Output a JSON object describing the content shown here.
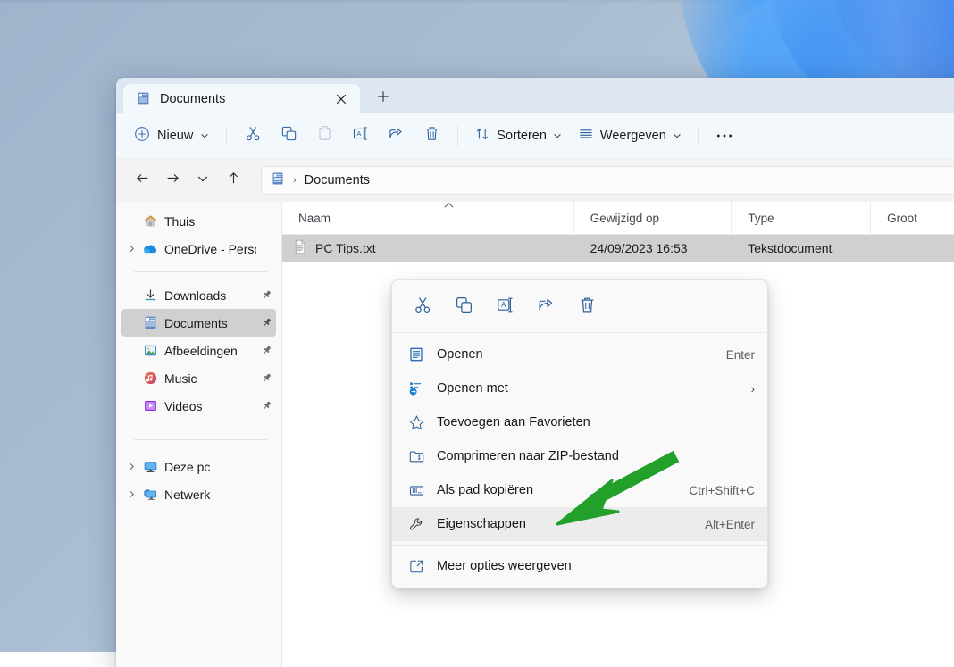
{
  "window": {
    "title": "Documents",
    "tab": {
      "label": "Documents",
      "icon": "documents-folder-icon",
      "close_icon": "close-icon"
    },
    "new_tab_icon": "plus-icon"
  },
  "toolbar": {
    "new_label": "Nieuw",
    "new_icon": "plus-circle-icon",
    "items": [
      {
        "name": "cut",
        "icon": "scissors-icon",
        "enabled": true
      },
      {
        "name": "copy",
        "icon": "copy-icon",
        "enabled": true
      },
      {
        "name": "paste",
        "icon": "paste-icon",
        "enabled": false
      },
      {
        "name": "rename",
        "icon": "rename-icon",
        "enabled": true
      },
      {
        "name": "share",
        "icon": "share-icon",
        "enabled": true
      },
      {
        "name": "delete",
        "icon": "trash-icon",
        "enabled": true
      }
    ],
    "sort_label": "Sorteren",
    "sort_icon": "sort-arrows-icon",
    "view_label": "Weergeven",
    "view_icon": "list-lines-icon",
    "more_label": "•••",
    "more_icon": "ellipsis-icon"
  },
  "address": {
    "back_icon": "arrow-left-icon",
    "forward_icon": "arrow-right-icon",
    "recent_icon": "chevron-down-icon",
    "up_icon": "arrow-up-icon",
    "path_icon": "documents-folder-icon",
    "separator": "›",
    "crumb": "Documents"
  },
  "sidebar": {
    "items": [
      {
        "label": "Thuis",
        "icon": "home-icon",
        "expandable": false,
        "pinned": false,
        "selected": false
      },
      {
        "label": "OneDrive - Persona",
        "icon": "onedrive-cloud-icon",
        "expandable": true,
        "pinned": false,
        "selected": false
      },
      {
        "divider": true
      },
      {
        "label": "Downloads",
        "icon": "download-icon",
        "expandable": false,
        "pinned": true,
        "selected": false
      },
      {
        "label": "Documents",
        "icon": "documents-icon",
        "expandable": false,
        "pinned": true,
        "selected": true
      },
      {
        "label": "Afbeeldingen",
        "icon": "pictures-icon",
        "expandable": false,
        "pinned": true,
        "selected": false
      },
      {
        "label": "Music",
        "icon": "music-icon",
        "expandable": false,
        "pinned": true,
        "selected": false
      },
      {
        "label": "Videos",
        "icon": "videos-icon",
        "expandable": false,
        "pinned": true,
        "selected": false
      },
      {
        "divider": true
      },
      {
        "label": "Deze pc",
        "icon": "this-pc-icon",
        "expandable": true,
        "pinned": false,
        "selected": false
      },
      {
        "label": "Netwerk",
        "icon": "network-icon",
        "expandable": true,
        "pinned": false,
        "selected": false
      }
    ],
    "pin_glyph": "📌"
  },
  "filelist": {
    "columns": [
      {
        "key": "name",
        "label": "Naam",
        "sorted": true,
        "sort_dir": "asc"
      },
      {
        "key": "modified",
        "label": "Gewijzigd op"
      },
      {
        "key": "type",
        "label": "Type"
      },
      {
        "key": "size",
        "label": "Groot"
      }
    ],
    "rows": [
      {
        "name": "PC Tips.txt",
        "modified": "24/09/2023 16:53",
        "type": "Tekstdocument",
        "size": "",
        "icon": "text-file-icon",
        "selected": true
      }
    ]
  },
  "context_menu": {
    "icon_row": [
      {
        "name": "cut",
        "icon": "scissors-icon"
      },
      {
        "name": "copy",
        "icon": "copy-icon"
      },
      {
        "name": "rename",
        "icon": "rename-icon"
      },
      {
        "name": "share",
        "icon": "share-icon"
      },
      {
        "name": "delete",
        "icon": "trash-icon"
      }
    ],
    "items": [
      {
        "label": "Openen",
        "accel": "Enter",
        "icon": "open-document-icon",
        "submenu": false,
        "highlighted": false
      },
      {
        "label": "Openen met",
        "accel": "",
        "icon": "open-with-icon",
        "submenu": true,
        "highlighted": false
      },
      {
        "label": "Toevoegen aan Favorieten",
        "accel": "",
        "icon": "star-icon",
        "submenu": false,
        "highlighted": false
      },
      {
        "label": "Comprimeren naar ZIP-bestand",
        "accel": "",
        "icon": "zip-folder-icon",
        "submenu": false,
        "highlighted": false
      },
      {
        "label": "Als pad kopiëren",
        "accel": "Ctrl+Shift+C",
        "icon": "copy-path-icon",
        "submenu": false,
        "highlighted": false
      },
      {
        "label": "Eigenschappen",
        "accel": "Alt+Enter",
        "icon": "wrench-icon",
        "submenu": false,
        "highlighted": true
      }
    ],
    "footer": {
      "label": "Meer opties weergeven",
      "icon": "more-options-icon"
    },
    "submenu_glyph": "›"
  },
  "annotation": {
    "arrow_color": "#22a02a",
    "name": "green-arrow-pointing-to-eigenschappen"
  },
  "colors": {
    "accent": "#2b5f99",
    "selection": "#d0d0d0",
    "window_bg": "#f3f3f3",
    "desktop": "#a8bcd2"
  }
}
